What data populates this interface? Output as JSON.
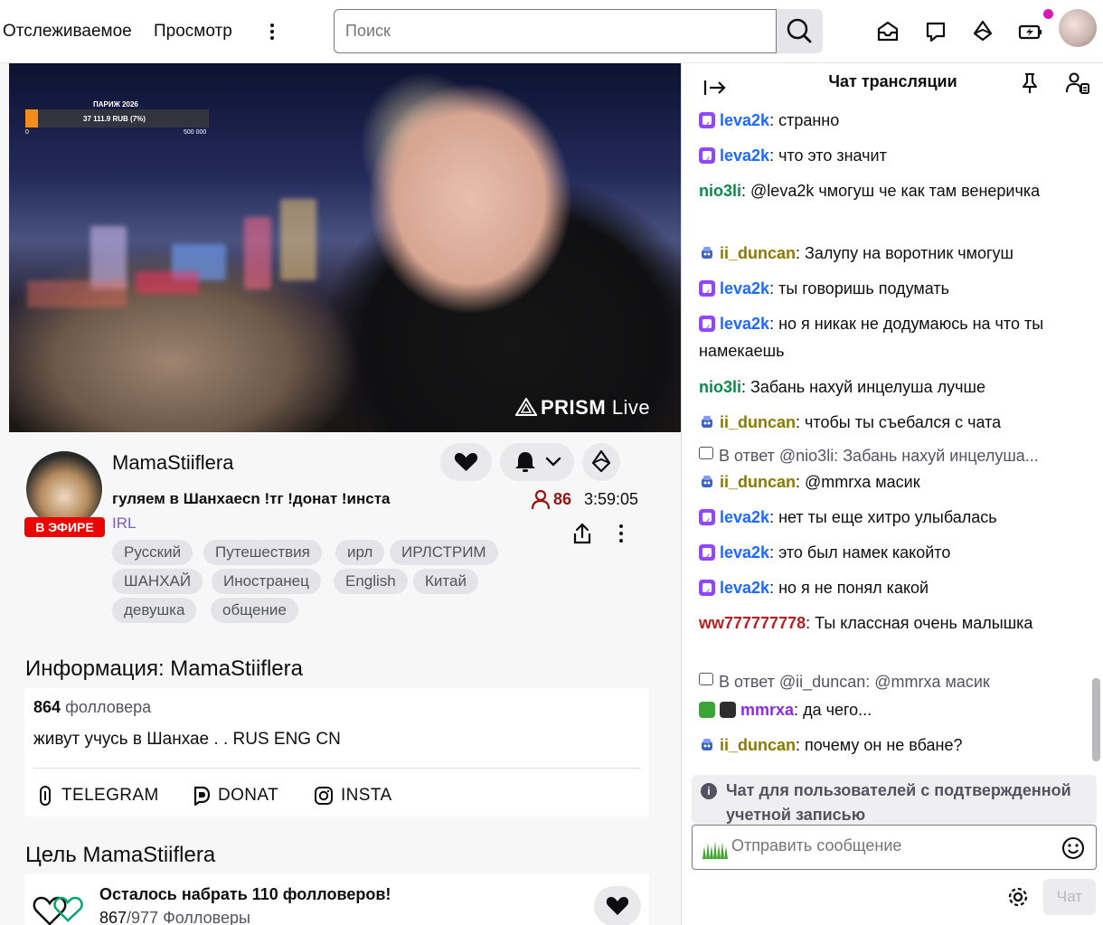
{
  "nav": {
    "following": "Отслеживаемое",
    "browse": "Просмотр",
    "search_placeholder": "Поиск",
    "icons": [
      "inbox-icon",
      "whispers-icon",
      "bits-icon",
      "prime-battery-icon"
    ]
  },
  "video": {
    "goal_title": "ПАРИЖ 2026",
    "goal_amount": "37 111.9 RUB (7%)",
    "goal_min": "0",
    "goal_max": "500 000",
    "goal_progress_fraction": 0.07,
    "prism_bold": "PRISM",
    "prism_light": "Live"
  },
  "channel": {
    "live_badge": "В ЭФИРЕ",
    "name": "MamaStiiflera",
    "title": "гуляем в Шанхаеcn !тг !донат !инста",
    "category": "IRL",
    "viewers": "86",
    "uptime": "3:59:05",
    "tags": [
      "Русский",
      "Путешествия",
      "ирл",
      "ИРЛСТРИМ",
      "ШАНХАЙ",
      "Иностранец",
      "English",
      "Китай",
      "девушка",
      "общение"
    ]
  },
  "about": {
    "title_prefix": "Информация:",
    "title_name": "MamaStiiflera",
    "followers_count": "864",
    "followers_label": "фолловера",
    "description": "живут учусь в Шанхае .      . RUS ENG CN",
    "links": [
      "TELEGRAM",
      "DONAT",
      "INSTA"
    ]
  },
  "goal": {
    "title_prefix": "Цель",
    "title_name": "MamaStiiflera",
    "text": "Осталось набрать 110 фолловеров!",
    "current": "867",
    "target": "/977",
    "unit": "Фолловеры"
  },
  "chat": {
    "title": "Чат трансляции",
    "colors": {
      "leva2k": "#1e69ff",
      "nio3li": "#0b8a4a",
      "ii_duncan": "#8a7a00",
      "ww777777778": "#b22222",
      "mmrxa": "#8a2be2"
    },
    "messages": [
      {
        "badge": "sub",
        "user": "leva2k",
        "sep": ":",
        "text": " странно"
      },
      {
        "badge": "sub",
        "user": "leva2k",
        "sep": ":",
        "text": " что это значит"
      },
      {
        "badge": "",
        "user": "nio3li",
        "sep": ":",
        "text": " @leva2k чмогуш че как там венеричка"
      },
      {
        "badge": "robot",
        "user": "ii_duncan",
        "sep": ":",
        "text": " Залупу на воротник чмогуш"
      },
      {
        "badge": "sub",
        "user": "leva2k",
        "sep": ":",
        "text": " ты говоришь подумать"
      },
      {
        "badge": "sub",
        "user": "leva2k",
        "sep": ":",
        "text": " но я никак не додумаюсь на что ты намекаешь"
      },
      {
        "badge": "",
        "user": "nio3li",
        "sep": ":",
        "text": " Забань нахуй инцелуша лучше"
      },
      {
        "badge": "robot",
        "user": "ii_duncan",
        "sep": ":",
        "text": " чтобы ты съебался с чата"
      },
      {
        "reply": "В ответ @nio3li: Забань нахуй инцелуша..."
      },
      {
        "badge": "robot",
        "user": "ii_duncan",
        "sep": ":",
        "text": " @mmrxa масик"
      },
      {
        "badge": "sub",
        "user": "leva2k",
        "sep": ":",
        "text": " нет ты еще хитро улыбалась"
      },
      {
        "badge": "sub",
        "user": "leva2k",
        "sep": ":",
        "text": " это был намек какойто"
      },
      {
        "badge": "sub",
        "user": "leva2k",
        "sep": ":",
        "text": " но я не понял какой"
      },
      {
        "badge": "",
        "user": "ww777777778",
        "sep": ":",
        "text": " Ты классная очень малышка"
      },
      {
        "reply": "В ответ @ii_duncan: @mmrxa масик"
      },
      {
        "badge": "sword-crown",
        "user": "mmrxa",
        "sep": ":",
        "text": " да чего..."
      },
      {
        "badge": "robot",
        "user": "ii_duncan",
        "sep": ":",
        "text": " почему он не вбане?"
      }
    ],
    "notice": "Чат для пользователей с подтвержденной учетной записью",
    "input_placeholder": "Отправить сообщение",
    "send_label": "Чат"
  }
}
